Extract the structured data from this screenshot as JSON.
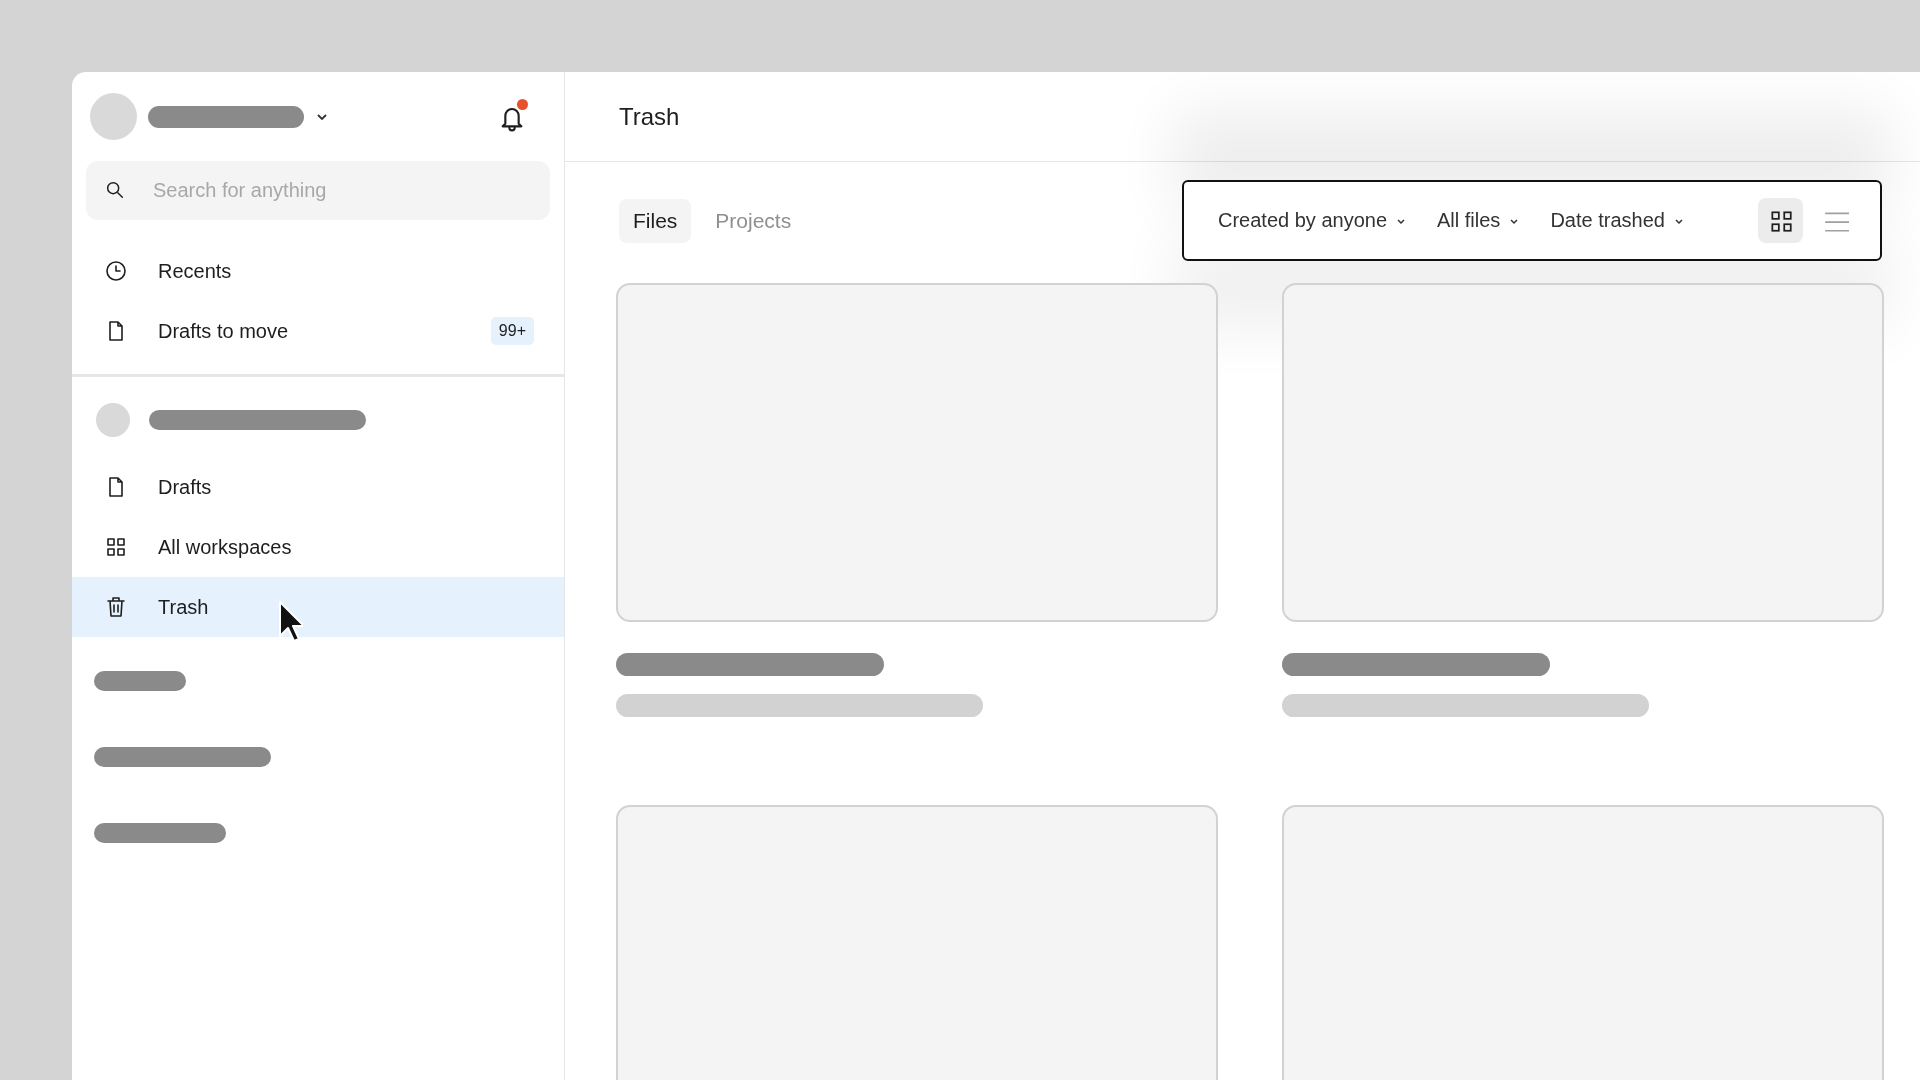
{
  "sidebar": {
    "notifications": {
      "unread": true
    },
    "search": {
      "placeholder": "Search for anything"
    },
    "top_items": [
      {
        "kind": "clock",
        "label": "Recents",
        "selected": false
      },
      {
        "kind": "file",
        "label": "Drafts to move",
        "badge": "99+",
        "selected": false
      }
    ],
    "workspace_items": [
      {
        "kind": "file",
        "label": "Drafts",
        "selected": false
      },
      {
        "kind": "grid",
        "label": "All workspaces",
        "selected": false
      },
      {
        "kind": "trash",
        "label": "Trash",
        "selected": true
      }
    ]
  },
  "main": {
    "title": "Trash",
    "tabs": [
      {
        "label": "Files",
        "selected": true
      },
      {
        "label": "Projects",
        "selected": false
      }
    ],
    "filters": [
      {
        "label": "Created by anyone"
      },
      {
        "label": "All files"
      },
      {
        "label": "Date trashed"
      }
    ],
    "view_toggles": [
      {
        "kind": "grid",
        "selected": true
      },
      {
        "kind": "list",
        "selected": false
      }
    ],
    "cards": [
      {
        "kind": "captioned"
      },
      {
        "kind": "captioned"
      },
      {
        "kind": "bare"
      },
      {
        "kind": "bare"
      }
    ]
  }
}
